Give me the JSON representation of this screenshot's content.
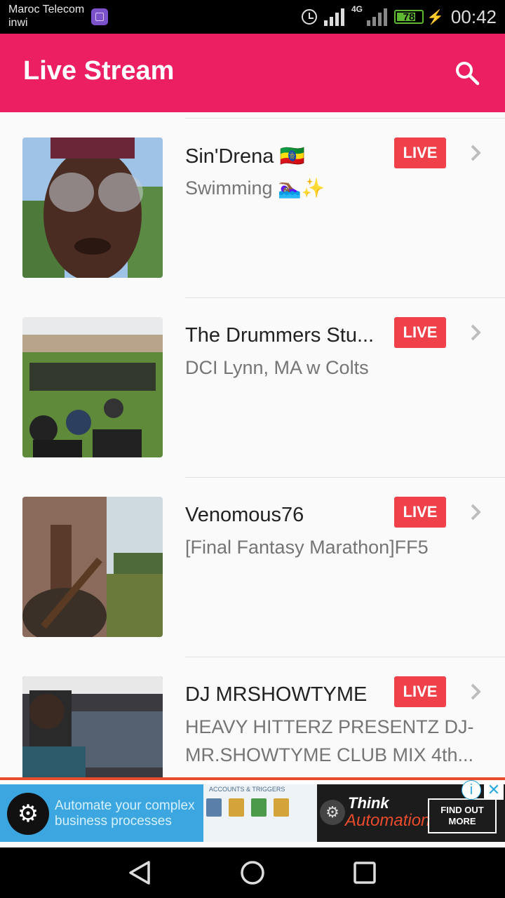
{
  "status": {
    "carrier_line1": "Maroc Telecom",
    "carrier_line2": "inwi",
    "network": "4G",
    "battery": "78",
    "battery_level": 0.78,
    "time": "00:42"
  },
  "header": {
    "title": "Live Stream",
    "background": "#ec1f63"
  },
  "streams": [
    {
      "title": "Sin'Drena 🇪🇹",
      "subtitle": "Swimming 🏊🏾‍♀️✨",
      "badge": "LIVE"
    },
    {
      "title": "The Drummers Stu...",
      "subtitle": "DCI Lynn, MA w Colts",
      "badge": "LIVE"
    },
    {
      "title": "Venomous76",
      "subtitle": "[Final Fantasy Marathon]FF5",
      "badge": "LIVE"
    },
    {
      "title": "DJ MRSHOWTYME",
      "subtitle": "HEAVY HITTERZ PRESENTZ DJ-MR.SHOWTYME CLUB MIX 4th...",
      "badge": "LIVE"
    }
  ],
  "ad": {
    "headline": "Automate your complex business processes",
    "panel_heading": "ACCOUNTS & TRIGGERS",
    "brand_line1": "Think",
    "brand_line2": "Automation",
    "cta": "FIND OUT MORE"
  },
  "colors": {
    "accent": "#ec1f63",
    "live_badge": "#f0404a",
    "battery": "#5fb832"
  },
  "icons": {
    "search": "search-icon",
    "chevron": "chevron-right-icon",
    "nav_back": "back-triangle-icon",
    "nav_home": "home-circle-icon",
    "nav_recent": "recent-square-icon"
  }
}
